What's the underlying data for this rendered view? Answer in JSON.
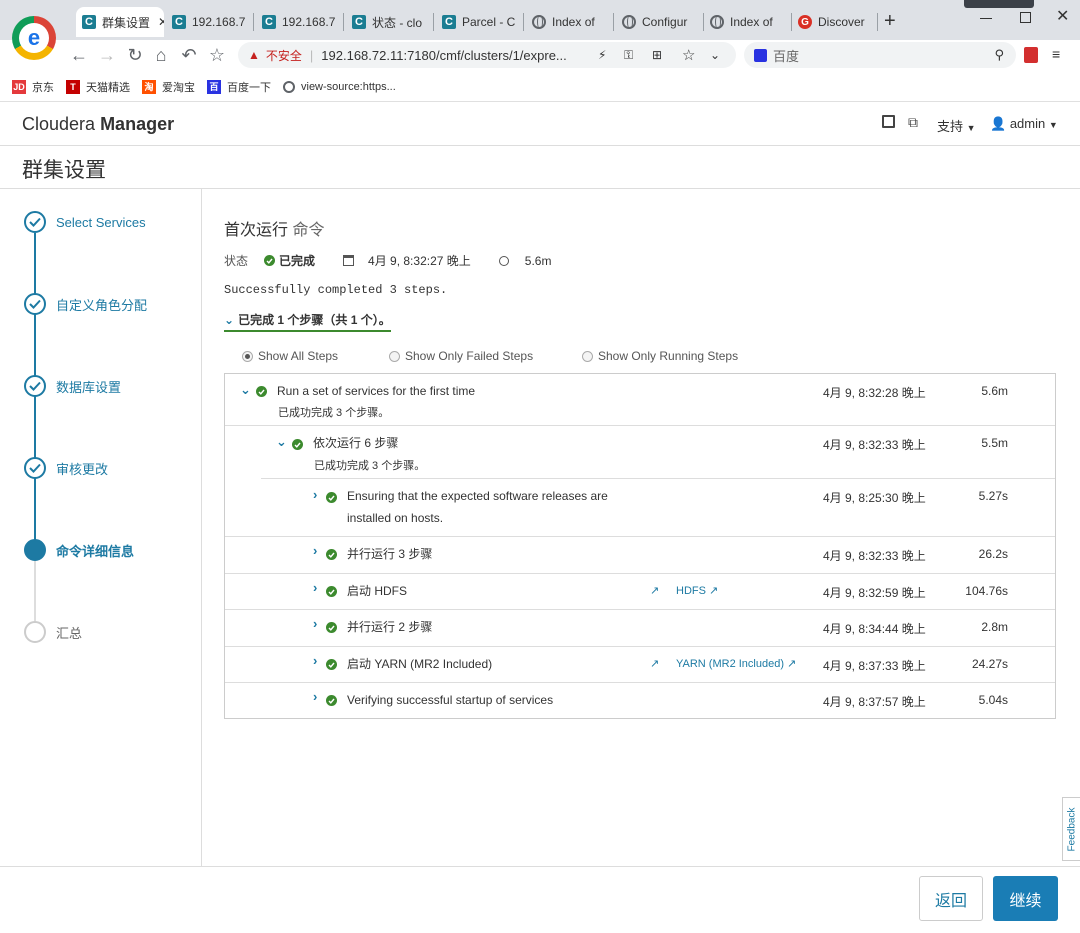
{
  "browser": {
    "tabs": [
      {
        "label": "群集设置",
        "favicon": "c-icon"
      },
      {
        "label": "192.168.7",
        "favicon": "c-icon"
      },
      {
        "label": "192.168.7",
        "favicon": "c-icon"
      },
      {
        "label": "状态 - clo",
        "favicon": "c-icon"
      },
      {
        "label": "Parcel - C",
        "favicon": "c-icon"
      },
      {
        "label": "Index of",
        "favicon": "globe-icon"
      },
      {
        "label": "Configur",
        "favicon": "globe-icon"
      },
      {
        "label": "Index of",
        "favicon": "globe-icon"
      },
      {
        "label": "Discover",
        "favicon": "g-icon"
      }
    ],
    "insecure_label": "不安全",
    "url": "192.168.72.11:7180/cmf/clusters/1/expre...",
    "search_placeholder": "百度",
    "bookmarks": [
      {
        "label": "京东",
        "icon": "jd-icon",
        "color": "#e4393c"
      },
      {
        "label": "天猫精选",
        "icon": "tmall-icon",
        "color": "#c40000"
      },
      {
        "label": "爱淘宝",
        "icon": "taobao-icon",
        "color": "#ff5000"
      },
      {
        "label": "百度一下",
        "icon": "baidu-icon",
        "color": "#2932e1"
      },
      {
        "label": "view-source:https...",
        "icon": "globe-icon",
        "color": "#5f6368"
      }
    ]
  },
  "app": {
    "brand_light": "Cloudera",
    "brand_bold": "Manager",
    "support_label": "支持",
    "user_label": "admin",
    "page_title": "群集设置"
  },
  "wizard_steps": [
    {
      "label": "Select Services",
      "state": "done"
    },
    {
      "label": "自定义角色分配",
      "state": "done"
    },
    {
      "label": "数据库设置",
      "state": "done"
    },
    {
      "label": "审核更改",
      "state": "done"
    },
    {
      "label": "命令详细信息",
      "state": "current"
    },
    {
      "label": "汇总",
      "state": "todo"
    }
  ],
  "command": {
    "title_a": "首次运行",
    "title_b": "命令",
    "status_label": "状态",
    "status_value": "已完成",
    "timestamp": "4月 9, 8:32:27 晚上",
    "duration": "5.6m",
    "message": "Successfully completed 3 steps.",
    "summary_toggle": "已完成 1 个步骤（共 1 个）。",
    "filters": [
      {
        "label": "Show All Steps",
        "selected": true
      },
      {
        "label": "Show Only Failed Steps",
        "selected": false
      },
      {
        "label": "Show Only Running Steps",
        "selected": false
      }
    ]
  },
  "steps": {
    "root": {
      "name": "Run a set of services for the first time",
      "sub": "已成功完成  3  个步骤。",
      "time": "4月 9, 8:32:28 晚上",
      "duration": "5.6m"
    },
    "seq": {
      "name": "依次运行 6 步骤",
      "sub": "已成功完成  3  个步骤。",
      "time": "4月 9, 8:32:33 晚上",
      "duration": "5.5m"
    },
    "children": [
      {
        "name": "Ensuring that the expected software releases are",
        "name2": "installed on hosts.",
        "time": "4月 9, 8:25:30 晚上",
        "duration": "5.27s"
      },
      {
        "name": "并行运行 3 步骤",
        "time": "4月 9, 8:32:33 晚上",
        "duration": "26.2s"
      },
      {
        "name": "启动 HDFS",
        "link": "HDFS",
        "time": "4月 9, 8:32:59 晚上",
        "duration": "104.76s"
      },
      {
        "name": "并行运行 2 步骤",
        "time": "4月 9, 8:34:44 晚上",
        "duration": "2.8m"
      },
      {
        "name": "启动 YARN (MR2 Included)",
        "link": "YARN (MR2 Included)",
        "time": "4月 9, 8:37:33 晚上",
        "duration": "24.27s"
      },
      {
        "name": "Verifying successful startup of services",
        "time": "4月 9, 8:37:57 晚上",
        "duration": "5.04s"
      }
    ]
  },
  "feedback_label": "Feedback",
  "buttons": {
    "back": "返回",
    "continue": "继续"
  },
  "colors": {
    "accent": "#1d7aa3",
    "success": "#3c8a2e",
    "primary_button": "#1a7db5"
  }
}
